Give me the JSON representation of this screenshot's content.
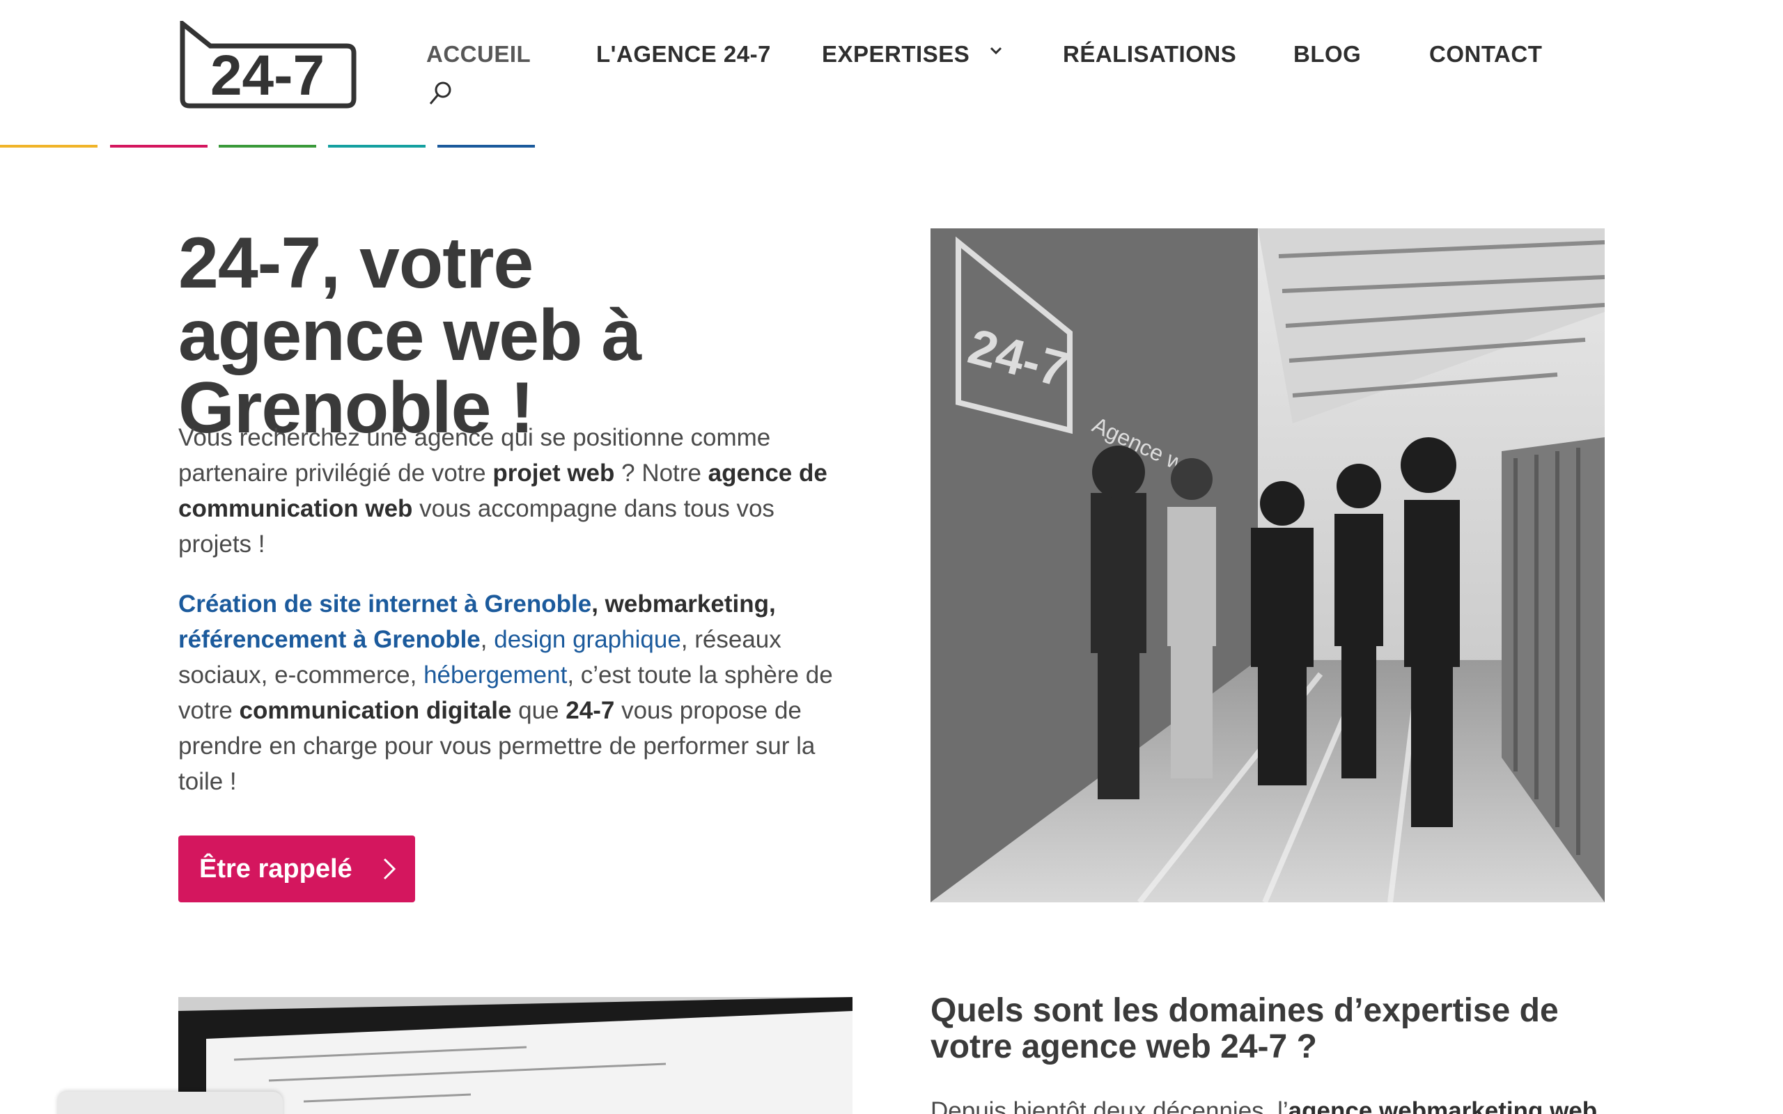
{
  "header": {
    "logo_text": "24-7",
    "nav": [
      {
        "label": "ACCUEIL"
      },
      {
        "label": "L'AGENCE 24-7"
      },
      {
        "label": "EXPERTISES"
      },
      {
        "label": "RÉALISATIONS"
      },
      {
        "label": "BLOG"
      },
      {
        "label": "CONTACT"
      }
    ],
    "bar_colors": [
      "#f0b429",
      "#d4165e",
      "#3a9a3a",
      "#14a0a0",
      "#1b5a9c"
    ]
  },
  "hero": {
    "title": "24-7, votre agence web à Grenoble !",
    "p1": {
      "t1": "Vous recherchez une agence qui se positionne comme partenaire privilégié de votre ",
      "b1": "projet web",
      "t2": " ? Notre ",
      "b2": "agence de communication web",
      "t3": " vous accompagne dans tous vos projets !"
    },
    "p2": {
      "a1": "Création de site internet à Grenoble",
      "b1": ", webmarketing, ",
      "a2": "référencement à Grenoble",
      "t1": ", ",
      "a3": "design graphique",
      "t2": ", réseaux sociaux, e-commerce, ",
      "a4": "hébergement",
      "t3": ", c’est toute la sphère de votre ",
      "b2": "communication digitale",
      "t4": " que ",
      "b3": "24-7",
      "t5": " vous propose de prendre en charge pour vous permettre de performer sur la toile !"
    },
    "cta_label": "Être rappelé",
    "photo_wall_logo": "24-7",
    "photo_wall_text": "Agence web"
  },
  "section2": {
    "title": "Quels sont les domaines d’expertise de votre agence web 24-7 ?",
    "para_start": "Depuis bientôt deux décennies, l’",
    "para_bold": "agence webmarketing web"
  },
  "colors": {
    "accent": "#d4165e",
    "link": "#1b5a9c",
    "text": "#3b3b3b"
  }
}
